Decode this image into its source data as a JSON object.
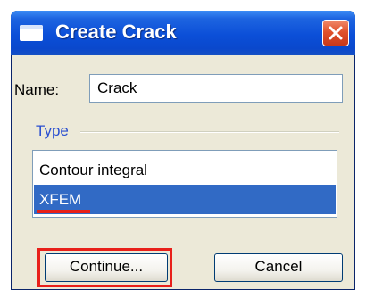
{
  "window": {
    "title": "Create Crack",
    "close_icon": "close-x-icon",
    "title_icon": "window-icon"
  },
  "form": {
    "name_label": "Name:",
    "name_value": "Crack",
    "type_label": "Type",
    "type_options": [
      "Contour integral",
      "XFEM"
    ],
    "selected_type": "XFEM"
  },
  "buttons": {
    "continue_label": "Continue...",
    "cancel_label": "Cancel"
  },
  "colors": {
    "titlebar": "#0b4fd8",
    "selection": "#316ac5",
    "highlight": "#e8201a",
    "type_label": "#2a4fd0"
  }
}
